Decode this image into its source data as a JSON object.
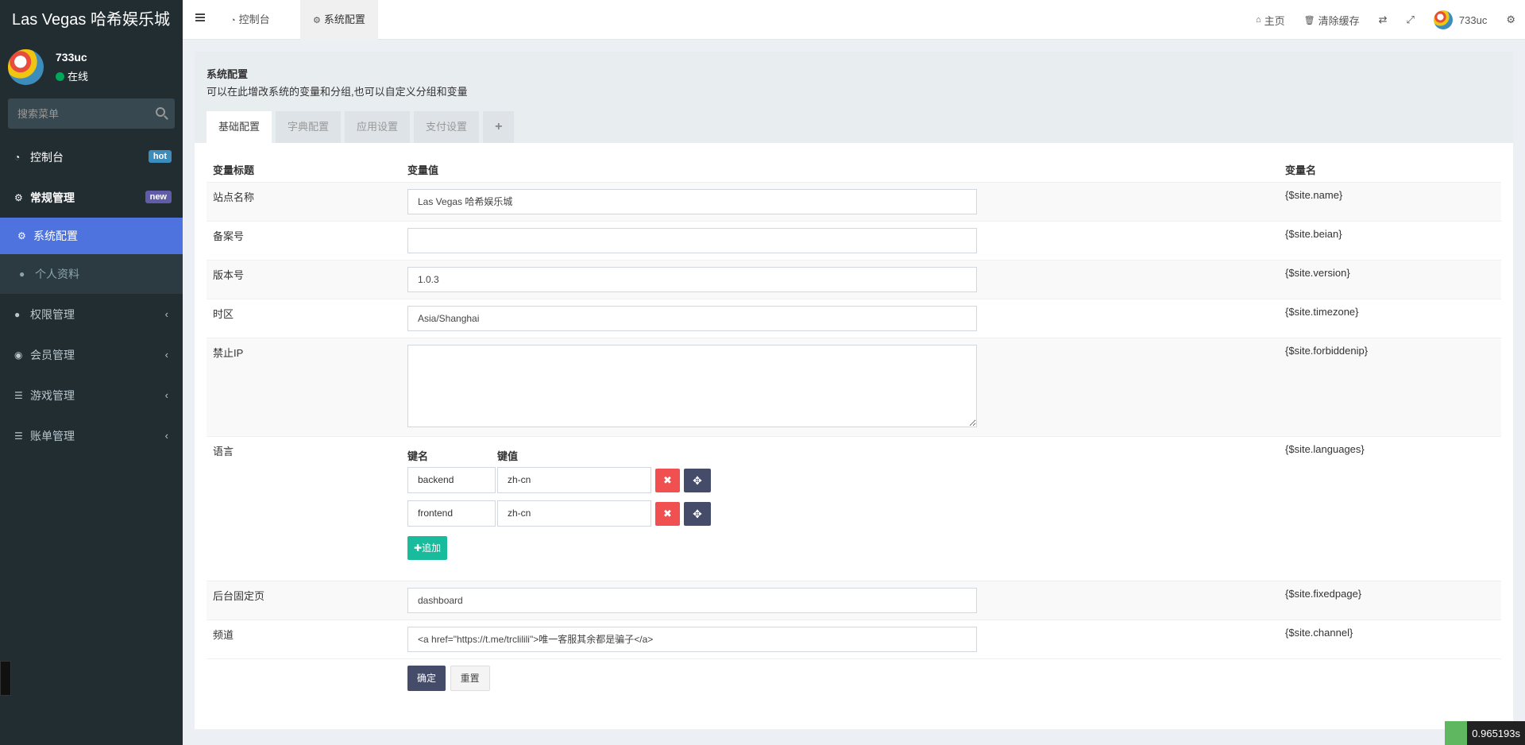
{
  "app": {
    "logo": "Las Vegas 哈希娱乐城"
  },
  "user": {
    "name": "733uc",
    "status": "在线"
  },
  "search": {
    "placeholder": "搜索菜单"
  },
  "menu": {
    "dashboard": {
      "label": "控制台",
      "badge": "hot",
      "badge_color": "#3c8dbc"
    },
    "general": {
      "label": "常规管理",
      "badge": "new",
      "badge_color": "#605ca8"
    },
    "config": {
      "label": "系统配置"
    },
    "profile": {
      "label": "个人资料"
    },
    "auth": {
      "label": "权限管理"
    },
    "member": {
      "label": "会员管理"
    },
    "game": {
      "label": "游戏管理"
    },
    "bill": {
      "label": "账单管理"
    }
  },
  "topbar": {
    "tabs": [
      "控制台",
      "系统配置"
    ],
    "home": "主页",
    "clear_cache": "清除缓存",
    "username": "733uc"
  },
  "panel": {
    "title": "系统配置",
    "description": "可以在此增改系统的变量和分组,也可以自定义分组和变量",
    "tabs": [
      "基础配置",
      "字典配置",
      "应用设置",
      "支付设置"
    ],
    "add_tab": "+"
  },
  "table": {
    "headers": [
      "变量标题",
      "变量值",
      "变量名"
    ],
    "rows": {
      "site_name": {
        "label": "站点名称",
        "value": "Las Vegas 哈希娱乐城",
        "var": "{$site.name}"
      },
      "beian": {
        "label": "备案号",
        "value": "",
        "var": "{$site.beian}"
      },
      "version": {
        "label": "版本号",
        "value": "1.0.3",
        "var": "{$site.version}"
      },
      "timezone": {
        "label": "时区",
        "value": "Asia/Shanghai",
        "var": "{$site.timezone}"
      },
      "forbiddenip": {
        "label": "禁止IP",
        "value": "",
        "var": "{$site.forbiddenip}"
      },
      "languages": {
        "label": "语言",
        "key_header": "键名",
        "value_header": "键值",
        "pairs": [
          {
            "key": "backend",
            "value": "zh-cn"
          },
          {
            "key": "frontend",
            "value": "zh-cn"
          }
        ],
        "add_label": "追加",
        "var": "{$site.languages}"
      },
      "fixedpage": {
        "label": "后台固定页",
        "value": "dashboard",
        "var": "{$site.fixedpage}"
      },
      "channel": {
        "label": "频道",
        "value": "<a href=\"https://t.me/trclilili\">唯一客服其余都是骗子</a>",
        "var": "{$site.channel}"
      }
    }
  },
  "buttons": {
    "submit": "确定",
    "reset": "重置"
  },
  "timer": "0.965193s"
}
